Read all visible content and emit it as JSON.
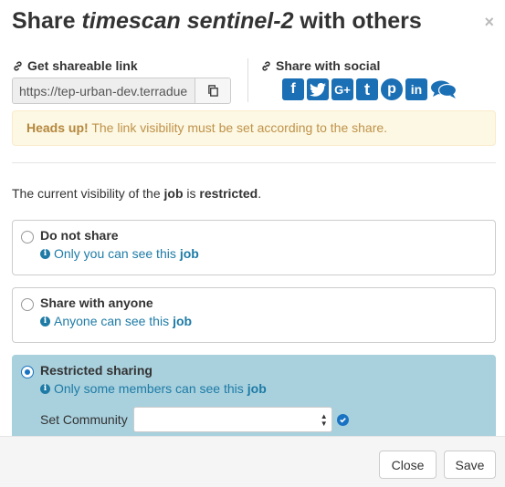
{
  "dialog": {
    "title_prefix": "Share ",
    "title_item": "timescan sentinel-2",
    "title_suffix": " with others",
    "close_glyph": "×"
  },
  "link_section": {
    "label": "Get shareable link",
    "url_value": "https://tep-urban-dev.terradue.com/",
    "icon": "link-icon",
    "copy_icon": "copy-icon"
  },
  "social_section": {
    "label": "Share with social",
    "icons": [
      "facebook-icon",
      "twitter-icon",
      "google-plus-icon",
      "tumblr-icon",
      "pinterest-icon",
      "linkedin-icon",
      "comments-icon"
    ],
    "glyphs": [
      "f",
      "t",
      "G+",
      "t",
      "p",
      "in",
      ""
    ],
    "brand_color": "#1a6fb5"
  },
  "alert": {
    "strong": "Heads up!",
    "text": " The link visibility must be set according to the share."
  },
  "visibility": {
    "prefix": "The current visibility of the ",
    "entity": "job",
    "middle": " is ",
    "state": "restricted",
    "suffix": "."
  },
  "options": [
    {
      "title": "Do not share",
      "desc_prefix": "Only you can see this ",
      "desc_entity": "job",
      "selected": false
    },
    {
      "title": "Share with anyone",
      "desc_prefix": "Anyone can see this ",
      "desc_entity": "job",
      "selected": false
    },
    {
      "title": "Restricted sharing",
      "desc_prefix": "Only some members can see this ",
      "desc_entity": "job",
      "selected": true
    }
  ],
  "community": {
    "label": "Set Community",
    "value": ""
  },
  "footer": {
    "close_label": "Close",
    "save_label": "Save"
  },
  "colors": {
    "selected_bg": "#a8d0dd",
    "info_text": "#1e7ba6",
    "alert_bg": "#fcf8e3"
  }
}
